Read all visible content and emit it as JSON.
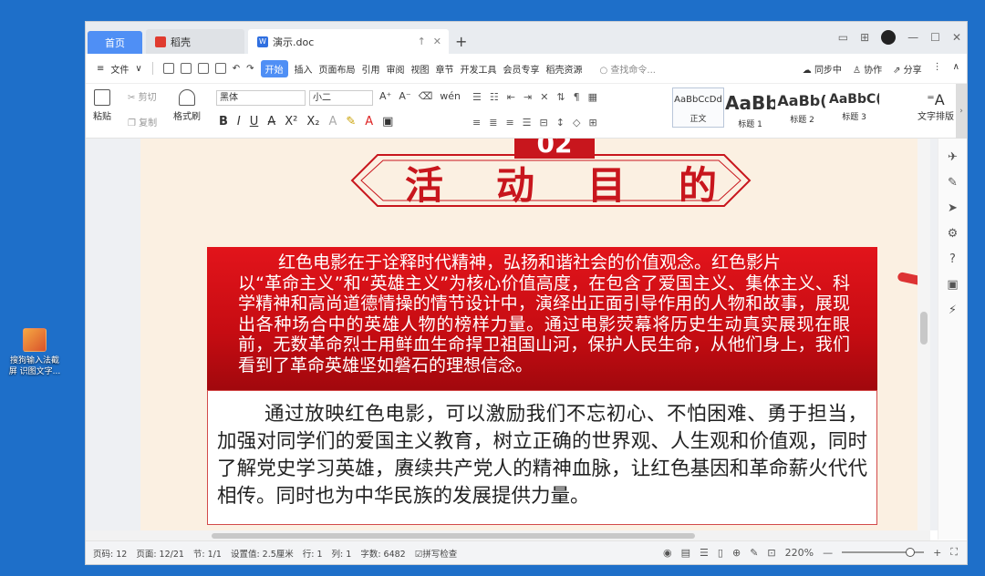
{
  "desktop": {
    "icon_label_line1": "搜狗输入法截",
    "icon_label_line2": "屏 识图文字..."
  },
  "tabs": {
    "home": "首页",
    "daoke": "稻壳",
    "doc": "演示.doc",
    "new_tab": "+"
  },
  "menu": {
    "file": "文件",
    "items": [
      "开始",
      "插入",
      "页面布局",
      "引用",
      "审阅",
      "视图",
      "章节",
      "开发工具",
      "会员专享",
      "稻壳资源"
    ],
    "search": "查找命令...",
    "sync": "同步中",
    "collab": "协作",
    "share": "分享"
  },
  "ribbon": {
    "paste": "粘贴",
    "cut": "剪切",
    "copy": "复制",
    "format_painter": "格式刷",
    "font": "黑体",
    "size": "小二",
    "styles": [
      {
        "sample": "AaBbCcDd",
        "label": "正文"
      },
      {
        "sample": "AaBb",
        "label": "标题 1"
      },
      {
        "sample": "AaBb(",
        "label": "标题 2"
      },
      {
        "sample": "AaBbC(",
        "label": "标题 3"
      }
    ],
    "text_layout": "文字排版"
  },
  "document": {
    "badge": "02",
    "title": "活动目的",
    "red_paragraph_first": "红色电影在于诠释时代精神，弘扬和谐社会的价值观念。红色影片",
    "red_paragraph_rest": "以“革命主义”和“英雄主义”为核心价值高度，在包含了爱国主义、集体主义、科学精神和高尚道德情操的情节设计中，演绎出正面引导作用的人物和故事，展现出各种场合中的英雄人物的榜样力量。通过电影荧幕将历史生动真实展现在眼前，无数革命烈士用鲜血生命捍卫祖国山河，保护人民生命，从他们身上，我们看到了革命英雄坚如磐石的理想信念。",
    "white_paragraph": "通过放映红色电影，可以激励我们不忘初心、不怕困难、勇于担当，加强对同学们的爱国主义教育，树立正确的世界观、人生观和价值观，同时了解党史学习英雄，赓续共产党人的精神血脉，让红色基因和革命薪火代代相传。同时也为中华民族的发展提供力量。"
  },
  "status": {
    "page": "页码: 12",
    "pages": "页面: 12/21",
    "section": "节: 1/1",
    "setting": "设置值: 2.5厘米",
    "row": "行: 1",
    "col": "列: 1",
    "words": "字数: 6482",
    "spell": "拼写检查",
    "zoom": "220%",
    "zoom_minus": "—",
    "zoom_plus": "+"
  }
}
